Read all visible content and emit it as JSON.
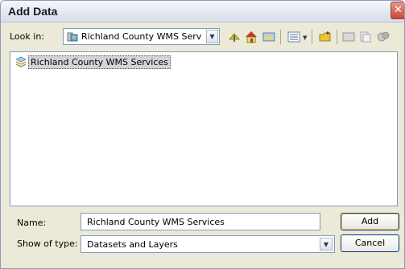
{
  "window": {
    "title": "Add Data",
    "close_glyph": "✕"
  },
  "lookin": {
    "label": "Look in:",
    "value": "Richland County WMS Services",
    "icon": "map-server-icon"
  },
  "toolbar": {
    "icons": [
      "up-one-level-icon",
      "home-icon",
      "connect-folder-icon",
      "view-options-icon",
      "new-folder-icon",
      "catalog-icon",
      "copy-icon",
      "delete-icon"
    ]
  },
  "file_list": {
    "items": [
      {
        "label": "Richland County WMS Services",
        "icon": "wms-service-icon",
        "selected": true
      }
    ]
  },
  "name_field": {
    "label": "Name:",
    "value": "Richland County WMS Services"
  },
  "type_field": {
    "label": "Show of type:",
    "value": "Datasets and Layers"
  },
  "buttons": {
    "add": "Add",
    "cancel": "Cancel"
  }
}
